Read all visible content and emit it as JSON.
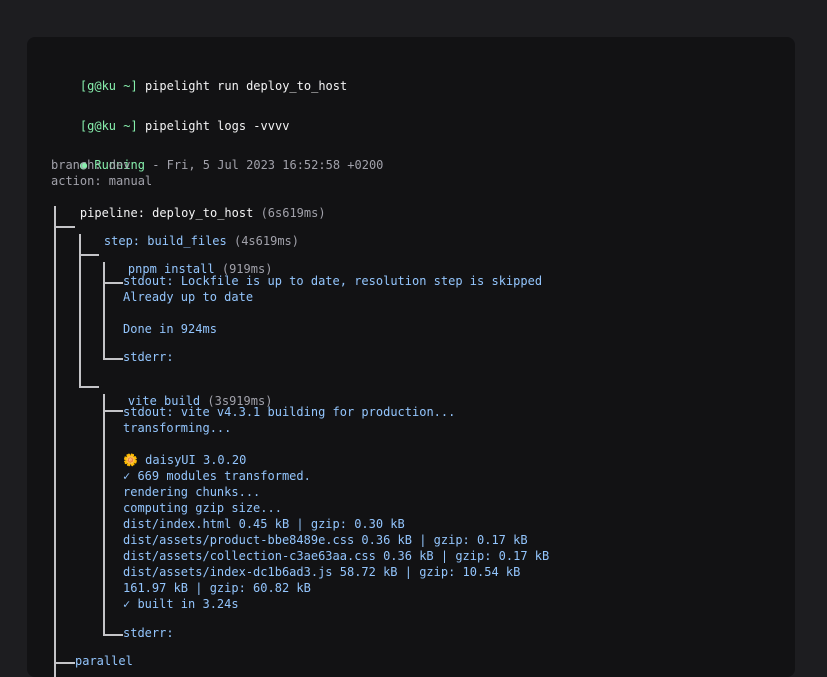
{
  "commands": [
    {
      "prompt": "[g@ku ~]",
      "command": "pipelight run deploy_to_host"
    },
    {
      "prompt": "[g@ku ~]",
      "command": "pipelight logs -vvvv"
    }
  ],
  "status": {
    "bullet": "●",
    "state": "Running",
    "separator": "-",
    "date": "Fri, 5 Jul 2023 16:52:58 +0200"
  },
  "meta": {
    "branch": "branch: dev",
    "action": "action: manual",
    "pipeline_label": "pipeline:",
    "pipeline_name": "deploy_to_host",
    "pipeline_duration": "(6s619ms)"
  },
  "step": {
    "label": "step:",
    "name": "build_files",
    "duration": "(4s619ms)"
  },
  "commands_run": [
    {
      "name": "pnpm install",
      "duration": "(919ms)",
      "stdout_label": "stdout:",
      "stdout": [
        "Lockfile is up to date, resolution step is skipped",
        "Already up to date",
        "",
        "Done in 924ms"
      ],
      "stderr_label": "stderr:"
    },
    {
      "name": "vite build",
      "duration": "(3s919ms)",
      "stdout_label": "stdout:",
      "stdout": [
        "vite v4.3.1 building for production...",
        "transforming...",
        "",
        "🌼 daisyUI 3.0.20",
        "✓ 669 modules transformed.",
        "rendering chunks...",
        "computing gzip size...",
        "dist/index.html 0.45 kB | gzip: 0.30 kB",
        "dist/assets/product-bbe8489e.css 0.36 kB | gzip: 0.17 kB",
        "dist/assets/collection-c3ae63aa.css 0.36 kB | gzip: 0.17 kB",
        "dist/assets/index-dc1b6ad3.js 58.72 kB | gzip: 10.54 kB",
        "161.97 kB | gzip: 60.82 kB",
        "✓ built in 3.24s"
      ],
      "stderr_label": "stderr:"
    }
  ],
  "parallel_label": "parallel"
}
